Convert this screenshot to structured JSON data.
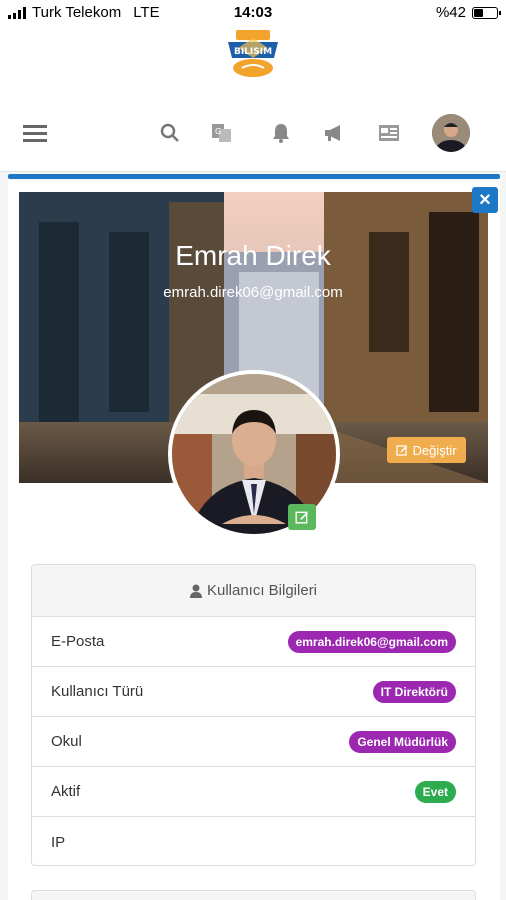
{
  "status_bar": {
    "carrier": "Turk Telekom",
    "network": "LTE",
    "time": "14:03",
    "battery_text": "%42",
    "battery_level": 0.42
  },
  "header": {
    "logo_text": "BILISIM",
    "nav_icons": [
      "menu-icon",
      "search-icon",
      "translate-icon",
      "bell-icon",
      "megaphone-icon",
      "news-icon"
    ]
  },
  "profile": {
    "name": "Emrah Direk",
    "email": "emrah.direk06@gmail.com",
    "change_cover_label": "Değiştir"
  },
  "user_info": {
    "title": "Kullanıcı Bilgileri",
    "rows": [
      {
        "label": "E-Posta",
        "value": "emrah.direk06@gmail.com",
        "badge_color": "purple"
      },
      {
        "label": "Kullanıcı Türü",
        "value": "IT Direktörü",
        "badge_color": "purple"
      },
      {
        "label": "Okul",
        "value": "Genel Müdürlük",
        "badge_color": "purple"
      },
      {
        "label": "Aktif",
        "value": "Evet",
        "badge_color": "green"
      },
      {
        "label": "IP",
        "value": "",
        "badge_color": ""
      }
    ]
  },
  "colors": {
    "primary": "#1e78c8",
    "badge_purple": "#9c27b0",
    "badge_green": "#2eaa4f",
    "warning": "#f0ad4e",
    "success": "#5cb85c"
  }
}
